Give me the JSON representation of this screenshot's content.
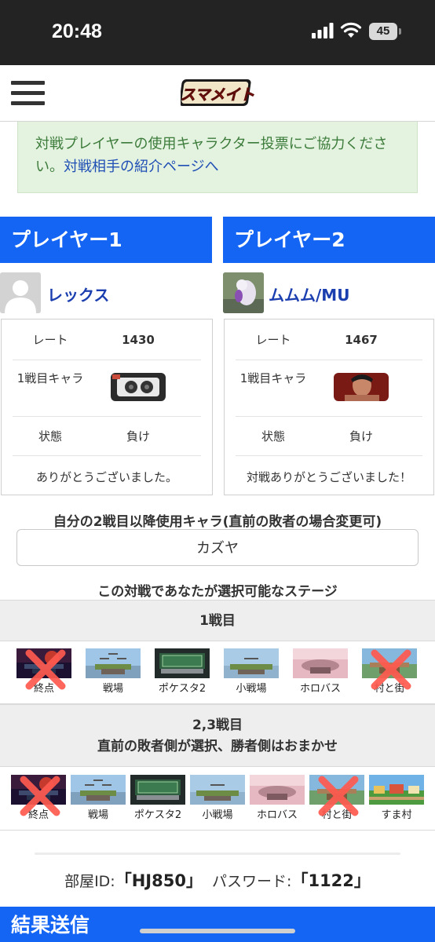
{
  "status_bar": {
    "time": "20:48",
    "battery": "45"
  },
  "header": {
    "logo_text": "スマメイト"
  },
  "notice": {
    "text": "対戦プレイヤーの使用キャラクター投票にご協力ください。",
    "link": "対戦相手の紹介ページへ"
  },
  "players": [
    {
      "header": "プレイヤー1",
      "name": "レックス",
      "rate_label": "レート",
      "rate": "1430",
      "char_label": "1戦目キャラ",
      "state_label": "状態",
      "state": "負け",
      "message": "ありがとうございました。"
    },
    {
      "header": "プレイヤー2",
      "name": "ムムム/MU",
      "rate_label": "レート",
      "rate": "1467",
      "char_label": "1戦目キャラ",
      "state_label": "状態",
      "state": "負け",
      "message": "対戦ありがとうございました！"
    }
  ],
  "char_select": {
    "title": "自分の2戦目以降使用キャラ(直前の敗者の場合変更可)",
    "value": "カズヤ"
  },
  "stages": {
    "title": "この対戦であなたが選択可能なステージ",
    "round1": {
      "label": "1戦目",
      "items": [
        {
          "name": "終点",
          "banned": true
        },
        {
          "name": "戦場",
          "banned": false
        },
        {
          "name": "ポケスタ2",
          "banned": false
        },
        {
          "name": "小戦場",
          "banned": false
        },
        {
          "name": "ホロバス",
          "banned": false
        },
        {
          "name": "村と街",
          "banned": true
        }
      ]
    },
    "round23": {
      "label": "2,3戦目",
      "sublabel": "直前の敗者側が選択、勝者側はおまかせ",
      "items": [
        {
          "name": "終点",
          "banned": true
        },
        {
          "name": "戦場",
          "banned": false
        },
        {
          "name": "ポケスタ2",
          "banned": false
        },
        {
          "name": "小戦場",
          "banned": false
        },
        {
          "name": "ホロバス",
          "banned": false
        },
        {
          "name": "村と街",
          "banned": true
        },
        {
          "name": "すま村",
          "banned": false
        }
      ]
    }
  },
  "room": {
    "id_label": "部屋ID:",
    "id": "「HJ850」",
    "pw_label": "パスワード:",
    "pw": "「1122」"
  },
  "submit": {
    "label": "結果送信"
  }
}
